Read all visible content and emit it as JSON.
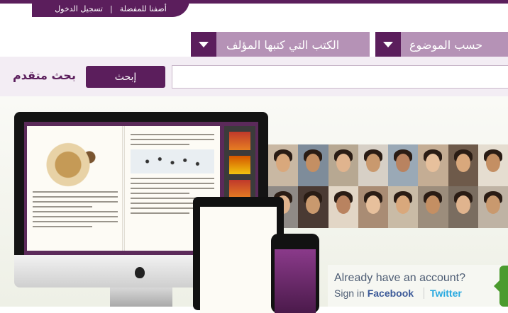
{
  "header": {
    "favorites_label": "أضفنا للمفضلة",
    "separator": "|",
    "login_label": "تسجيل الدخول"
  },
  "nav": {
    "by_author_label": "الكتب التي كتبها المؤلف",
    "by_topic_label": "حسب الموضوع"
  },
  "search": {
    "button_label": "إبحث",
    "advanced_label": "بحث متقدم",
    "input_value": ""
  },
  "account": {
    "title": "Already have an account?",
    "sign_in_label": "Sign in",
    "facebook_label": "Facebook",
    "twitter_label": "Twitter"
  },
  "colors": {
    "brand": "#5b1e5c",
    "nav_light": "#b592b6",
    "search_band": "#f3edf4",
    "facebook": "#3b5998",
    "twitter": "#29a9e0",
    "cta_green": "#4b9b2e"
  },
  "face_tiles": 16
}
